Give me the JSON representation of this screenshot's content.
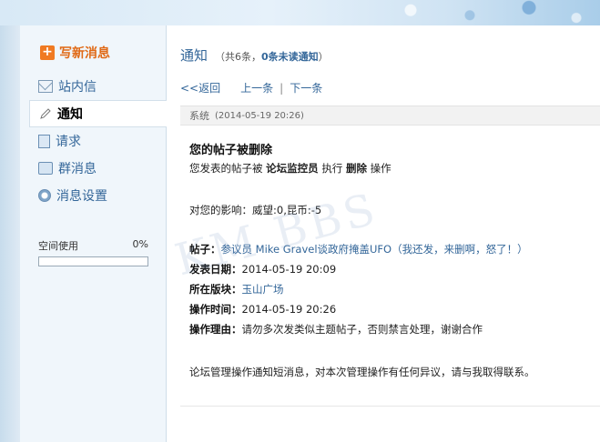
{
  "sidebar": {
    "compose_label": "写新消息",
    "items": [
      {
        "label": "站内信",
        "icon": "mail-icon"
      },
      {
        "label": "通知",
        "icon": "pencil-icon",
        "active": true
      },
      {
        "label": "请求",
        "icon": "document-icon"
      },
      {
        "label": "群消息",
        "icon": "chat-icon"
      },
      {
        "label": "消息设置",
        "icon": "settings-icon"
      }
    ],
    "storage": {
      "label": "空间使用",
      "percent": "0%",
      "usage": 0
    }
  },
  "main": {
    "title": "通知",
    "count_prefix": "（共6条，",
    "count_unread": "0条未读通知",
    "count_suffix": "）",
    "back_link": "<<返回",
    "prev_link": "上一条",
    "link_sep": "|",
    "next_link": "下一条"
  },
  "message": {
    "sender": "系统",
    "time": "(2014-05-19 20:26)",
    "title": "您的帖子被删除",
    "action_prefix": "您发表的帖子被",
    "actor": "论坛监控员",
    "action_mid": "执行",
    "action": "删除",
    "action_suffix": "操作",
    "impact": "对您的影响：威望:0,昆币:-5",
    "post_label": "帖子：",
    "post_value": "参议员 Mike Gravel谈政府掩盖UFO（我还发，来删啊，怒了！）",
    "date_label": "发表日期：",
    "date_value": "2014-05-19 20:09",
    "forum_label": "所在版块：",
    "forum_value": "玉山广场",
    "optime_label": "操作时间：",
    "optime_value": "2014-05-19 20:26",
    "reason_label": "操作理由：",
    "reason_value": "请勿多次发类似主题帖子，否则禁言处理，谢谢合作",
    "footer": "论坛管理操作通知短消息，对本次管理操作有任何异议，请与我取得联系。"
  },
  "watermark": "KM BBS",
  "colors": {
    "accent": "#336699",
    "compose": "#e06a17"
  }
}
